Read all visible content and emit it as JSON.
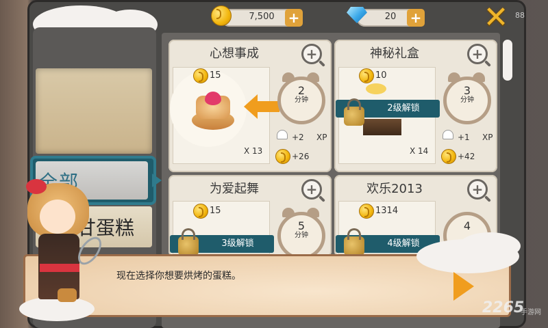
{
  "currency": {
    "coins": "7,500",
    "gems": "20",
    "coin_plus": "+",
    "gem_plus": "+",
    "edge_badge": "88"
  },
  "close_label": "✕",
  "categories": {
    "all": "全部",
    "cake": "甘蛋糕"
  },
  "cakes": [
    {
      "title": "心想事成",
      "price": "15",
      "time": "2",
      "time_unit": "分钟",
      "xp": "+2",
      "xp_label": "XP",
      "reward": "+26",
      "count": "X 13",
      "locked": false,
      "lock_text": ""
    },
    {
      "title": "神秘礼盒",
      "price": "10",
      "time": "3",
      "time_unit": "分钟",
      "xp": "+1",
      "xp_label": "XP",
      "reward": "+42",
      "count": "X 14",
      "locked": true,
      "lock_text": "2级解锁"
    },
    {
      "title": "为爱起舞",
      "price": "15",
      "time": "5",
      "time_unit": "分钟",
      "locked": true,
      "lock_text": "3级解锁"
    },
    {
      "title": "欢乐2013",
      "price": "1314",
      "time": "4",
      "time_unit": "",
      "locked": true,
      "lock_text": "4级解锁"
    }
  ],
  "dialog": {
    "text": "现在选择你想要烘烤的蛋糕。"
  },
  "watermark": {
    "main": "2265",
    "sub": "手游网"
  },
  "colors": {
    "accent_teal": "#1f5c6b",
    "arrow_orange": "#f09d1e",
    "coin_gold": "#f2b50c",
    "card_bg": "#ece6da"
  }
}
